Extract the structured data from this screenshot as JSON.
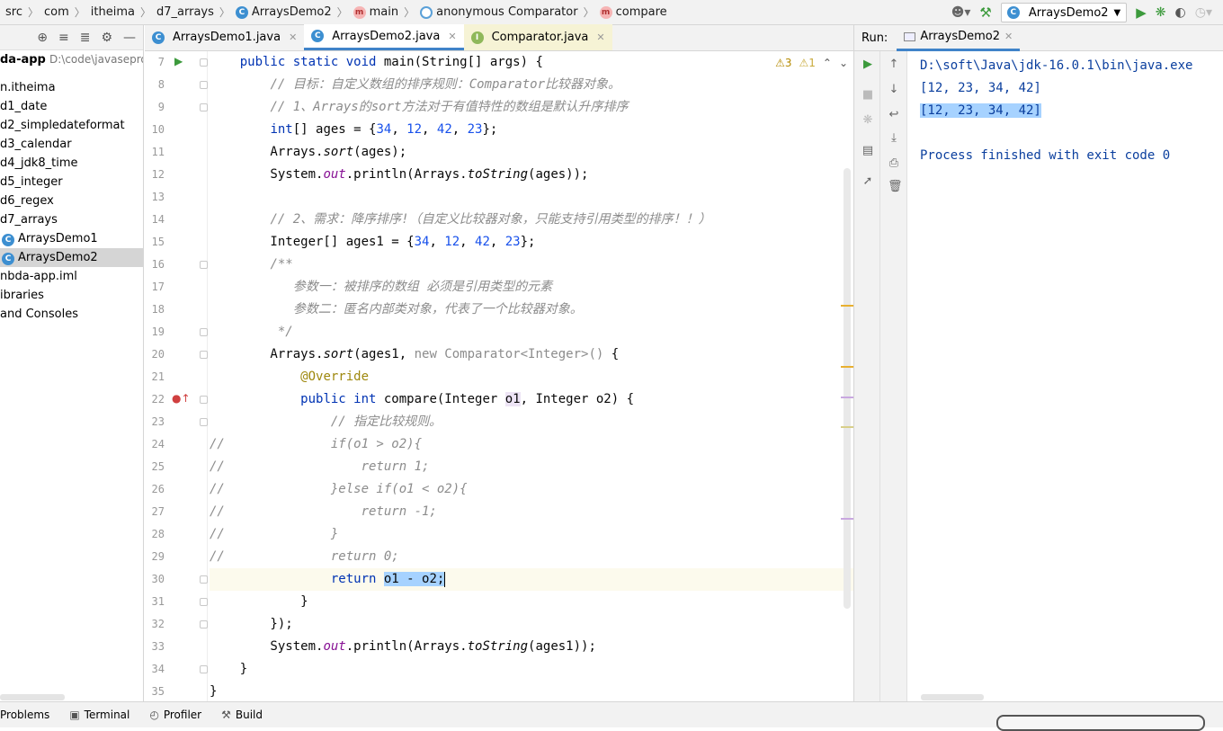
{
  "breadcrumbs": [
    "src",
    "com",
    "itheima",
    "d7_arrays",
    "ArraysDemo2",
    "main",
    "anonymous Comparator",
    "compare"
  ],
  "run_config": "ArraysDemo2",
  "project": {
    "root_label": "da-app",
    "root_path": "D:\\code\\javasepro",
    "items": [
      {
        "label": "n.itheima",
        "indent": 0
      },
      {
        "label": "d1_date",
        "indent": 0
      },
      {
        "label": "d2_simpledateformat",
        "indent": 0
      },
      {
        "label": "d3_calendar",
        "indent": 0
      },
      {
        "label": "d4_jdk8_time",
        "indent": 0
      },
      {
        "label": "d5_integer",
        "indent": 0
      },
      {
        "label": "d6_regex",
        "indent": 0
      },
      {
        "label": "d7_arrays",
        "indent": 0
      },
      {
        "label": "ArraysDemo1",
        "indent": 1
      },
      {
        "label": "ArraysDemo2",
        "indent": 1,
        "selected": true
      },
      {
        "label": "nbda-app.iml",
        "indent": 0
      },
      {
        "label": "ibraries",
        "indent": 0
      },
      {
        "label": " and Consoles",
        "indent": 0
      }
    ]
  },
  "tabs": [
    {
      "label": "ArraysDemo1.java",
      "active": false
    },
    {
      "label": "ArraysDemo2.java",
      "active": true
    },
    {
      "label": "Comparator.java",
      "active": false
    }
  ],
  "inspections": {
    "warnings": "3",
    "weak_warnings": "1"
  },
  "line_numbers": [
    "7",
    "8",
    "9",
    "10",
    "11",
    "12",
    "13",
    "14",
    "15",
    "16",
    "17",
    "18",
    "19",
    "20",
    "21",
    "22",
    "23",
    "24",
    "25",
    "26",
    "27",
    "28",
    "29",
    "30",
    "31",
    "32",
    "33",
    "34",
    "35"
  ],
  "code_lines": [
    [
      [
        "    ",
        ""
      ],
      [
        "public static void ",
        "kw"
      ],
      [
        "main(String[] args) {",
        ""
      ]
    ],
    [
      [
        "        ",
        ""
      ],
      [
        "// 目标：自定义数组的排序规则：Comparator比较器对象。",
        "cm"
      ]
    ],
    [
      [
        "        ",
        ""
      ],
      [
        "// 1、Arrays的sort方法对于有值特性的数组是默认升序排序",
        "cm"
      ]
    ],
    [
      [
        "        ",
        ""
      ],
      [
        "int",
        "kw"
      ],
      [
        "[] ages = {",
        ""
      ],
      [
        "34",
        "num"
      ],
      [
        ", ",
        ""
      ],
      [
        "12",
        "num"
      ],
      [
        ", ",
        ""
      ],
      [
        "42",
        "num"
      ],
      [
        ", ",
        ""
      ],
      [
        "23",
        "num"
      ],
      [
        "};",
        ""
      ]
    ],
    [
      [
        "        Arrays.",
        ""
      ],
      [
        "sort",
        "mc"
      ],
      [
        "(ages);",
        ""
      ]
    ],
    [
      [
        "        System.",
        ""
      ],
      [
        "out",
        "st"
      ],
      [
        ".println(Arrays.",
        ""
      ],
      [
        "toString",
        "mc"
      ],
      [
        "(ages));",
        ""
      ]
    ],
    [
      [
        "",
        ""
      ]
    ],
    [
      [
        "        ",
        ""
      ],
      [
        "// 2、需求：降序排序!（自定义比较器对象，只能支持引用类型的排序！！）",
        "cm"
      ]
    ],
    [
      [
        "        Integer[] ages1 = {",
        ""
      ],
      [
        "34",
        "num"
      ],
      [
        ", ",
        ""
      ],
      [
        "12",
        "num"
      ],
      [
        ", ",
        ""
      ],
      [
        "42",
        "num"
      ],
      [
        ", ",
        ""
      ],
      [
        "23",
        "num"
      ],
      [
        "};",
        ""
      ]
    ],
    [
      [
        "        ",
        ""
      ],
      [
        "/**",
        "cm"
      ]
    ],
    [
      [
        "           ",
        ""
      ],
      [
        "参数一：被排序的数组 必须是引用类型的元素",
        "cm"
      ]
    ],
    [
      [
        "           ",
        ""
      ],
      [
        "参数二：匿名内部类对象，代表了一个比较器对象。",
        "cm"
      ]
    ],
    [
      [
        "         ",
        ""
      ],
      [
        "*/",
        "cm"
      ]
    ],
    [
      [
        "        Arrays.",
        ""
      ],
      [
        "sort",
        "mc"
      ],
      [
        "(ages1, ",
        ""
      ],
      [
        "new Comparator<Integer>() ",
        "dim"
      ],
      [
        "{",
        ""
      ]
    ],
    [
      [
        "            ",
        ""
      ],
      [
        "@Override",
        "an"
      ]
    ],
    [
      [
        "            ",
        ""
      ],
      [
        "public int ",
        "kw"
      ],
      [
        "compare(Integer ",
        ""
      ],
      [
        "o1",
        "pl"
      ],
      [
        ", Integer o2) {",
        ""
      ]
    ],
    [
      [
        "                ",
        ""
      ],
      [
        "// 指定比较规则。",
        "cm"
      ]
    ],
    [
      [
        "",
        ""
      ],
      [
        "//",
        "cm"
      ],
      [
        "              if(o1 > o2){",
        "cm"
      ]
    ],
    [
      [
        "",
        ""
      ],
      [
        "//",
        "cm"
      ],
      [
        "                  return 1;",
        "cm"
      ]
    ],
    [
      [
        "",
        ""
      ],
      [
        "//",
        "cm"
      ],
      [
        "              }else if(o1 < o2){",
        "cm"
      ]
    ],
    [
      [
        "",
        ""
      ],
      [
        "//",
        "cm"
      ],
      [
        "                  return -1;",
        "cm"
      ]
    ],
    [
      [
        "",
        ""
      ],
      [
        "//",
        "cm"
      ],
      [
        "              }",
        "cm"
      ]
    ],
    [
      [
        "",
        ""
      ],
      [
        "//",
        "cm"
      ],
      [
        "              return 0;",
        "cm"
      ]
    ],
    [
      [
        "                ",
        ""
      ],
      [
        "return ",
        "kw"
      ],
      [
        "o1 - o2;",
        "hl"
      ]
    ],
    [
      [
        "            }",
        ""
      ]
    ],
    [
      [
        "        });",
        ""
      ]
    ],
    [
      [
        "        System.",
        ""
      ],
      [
        "out",
        "st"
      ],
      [
        ".println(Arrays.",
        ""
      ],
      [
        "toString",
        "mc"
      ],
      [
        "(ages1));",
        ""
      ]
    ],
    [
      [
        "    }",
        ""
      ]
    ],
    [
      [
        "}",
        ""
      ]
    ]
  ],
  "current_line_index": 23,
  "run": {
    "label": "Run:",
    "tab": "ArraysDemo2",
    "output": [
      {
        "text": "D:\\soft\\Java\\jdk-16.0.1\\bin\\java.exe",
        "highlight": false
      },
      {
        "text": "[12, 23, 34, 42]",
        "highlight": false
      },
      {
        "text": "[12, 23, 34, 42]",
        "highlight": true
      },
      {
        "text": "",
        "highlight": false
      },
      {
        "text": "Process finished with exit code 0",
        "highlight": false
      }
    ]
  },
  "bottom_tools": [
    "Problems",
    "Terminal",
    "Profiler",
    "Build"
  ],
  "colors": {
    "accent": "#4083c9",
    "keyword": "#0033b3",
    "number": "#1750eb",
    "comment": "#8c8c8c",
    "run_green": "#3c9a3c"
  }
}
